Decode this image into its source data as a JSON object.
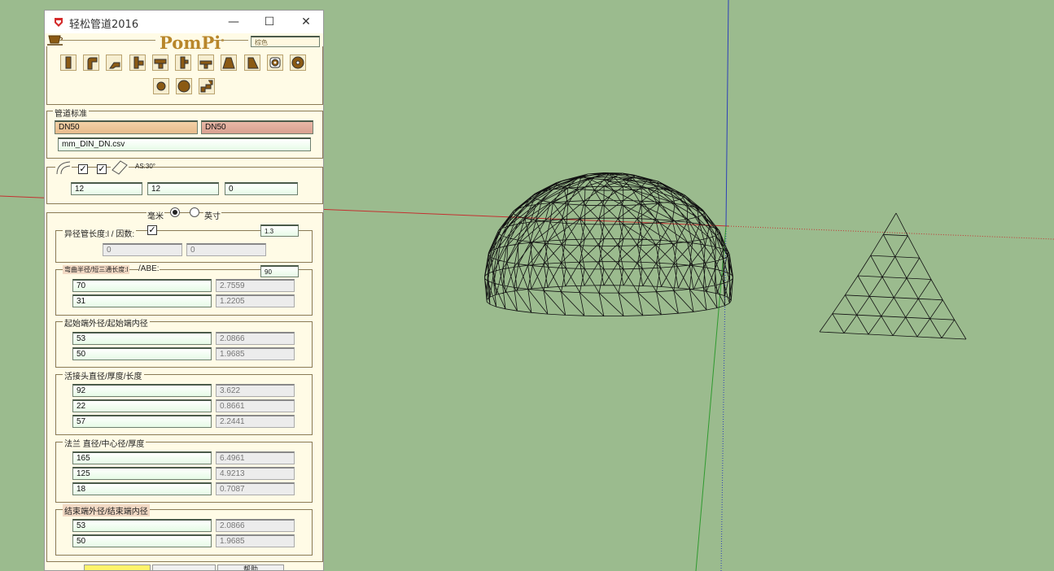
{
  "window": {
    "title": "轻松管道2016",
    "minimize": "—",
    "maximize": "☐",
    "close": "✕"
  },
  "logo": {
    "text": "PomPi",
    "superscript": "°"
  },
  "color_field": "棕色",
  "toolbar_icons": [
    "straight-pipe-icon",
    "elbow-90-icon",
    "elbow-45-icon",
    "tee-side-icon",
    "tee-top-icon",
    "tee-branch-icon",
    "tee-reducer-icon",
    "reducer-cone-icon",
    "eccentric-reducer-icon",
    "flange-ring-icon",
    "flange-disc-icon",
    "cap-round-icon",
    "end-disc-icon",
    "s-bend-icon"
  ],
  "pipe_standard": {
    "legend": "管道标准",
    "value_start": "DN50",
    "value_end": "DN50",
    "file": "mm_DIN_DN.csv"
  },
  "segments": {
    "angle_label": "AS:30°",
    "check1": "✓",
    "check2": "✓",
    "values": [
      "12",
      "12",
      "0"
    ]
  },
  "units": {
    "mm_label": "毫米",
    "inch_label": "英寸",
    "selected": "mm"
  },
  "reducer": {
    "legend": "异径管长度:l / 因数:",
    "check": "✓",
    "factor": "1.3",
    "values": [
      "0",
      "0"
    ]
  },
  "bend": {
    "legend": "弯曲半径/短三通长度:l",
    "suffix": "/ABE:",
    "abe": "90",
    "rows": [
      [
        "70",
        "2.7559"
      ],
      [
        "31",
        "1.2205"
      ]
    ]
  },
  "start_diameter": {
    "legend": "起始端外径/起始端内径",
    "rows": [
      [
        "53",
        "2.0866"
      ],
      [
        "50",
        "1.9685"
      ]
    ]
  },
  "union": {
    "legend": "活接头直径/厚度/长度",
    "rows": [
      [
        "92",
        "3.622"
      ],
      [
        "22",
        "0.8661"
      ],
      [
        "57",
        "2.2441"
      ]
    ]
  },
  "flange": {
    "legend": "法兰 直径/中心径/厚度",
    "rows": [
      [
        "165",
        "6.4961"
      ],
      [
        "125",
        "4.9213"
      ],
      [
        "18",
        "0.7087"
      ]
    ]
  },
  "end_diameter": {
    "legend": "结束端外径/结束端内径",
    "rows": [
      [
        "53",
        "2.0866"
      ],
      [
        "50",
        "1.9685"
      ]
    ]
  },
  "bottom": {
    "help": "帮助"
  },
  "colors": {
    "background": "#9bbb8e",
    "panel": "#fffbe6",
    "pipe_brown": "#8b5a14",
    "axis_red": "#c43030",
    "axis_green": "#2f9a2f",
    "axis_blue": "#2d3fb8"
  }
}
